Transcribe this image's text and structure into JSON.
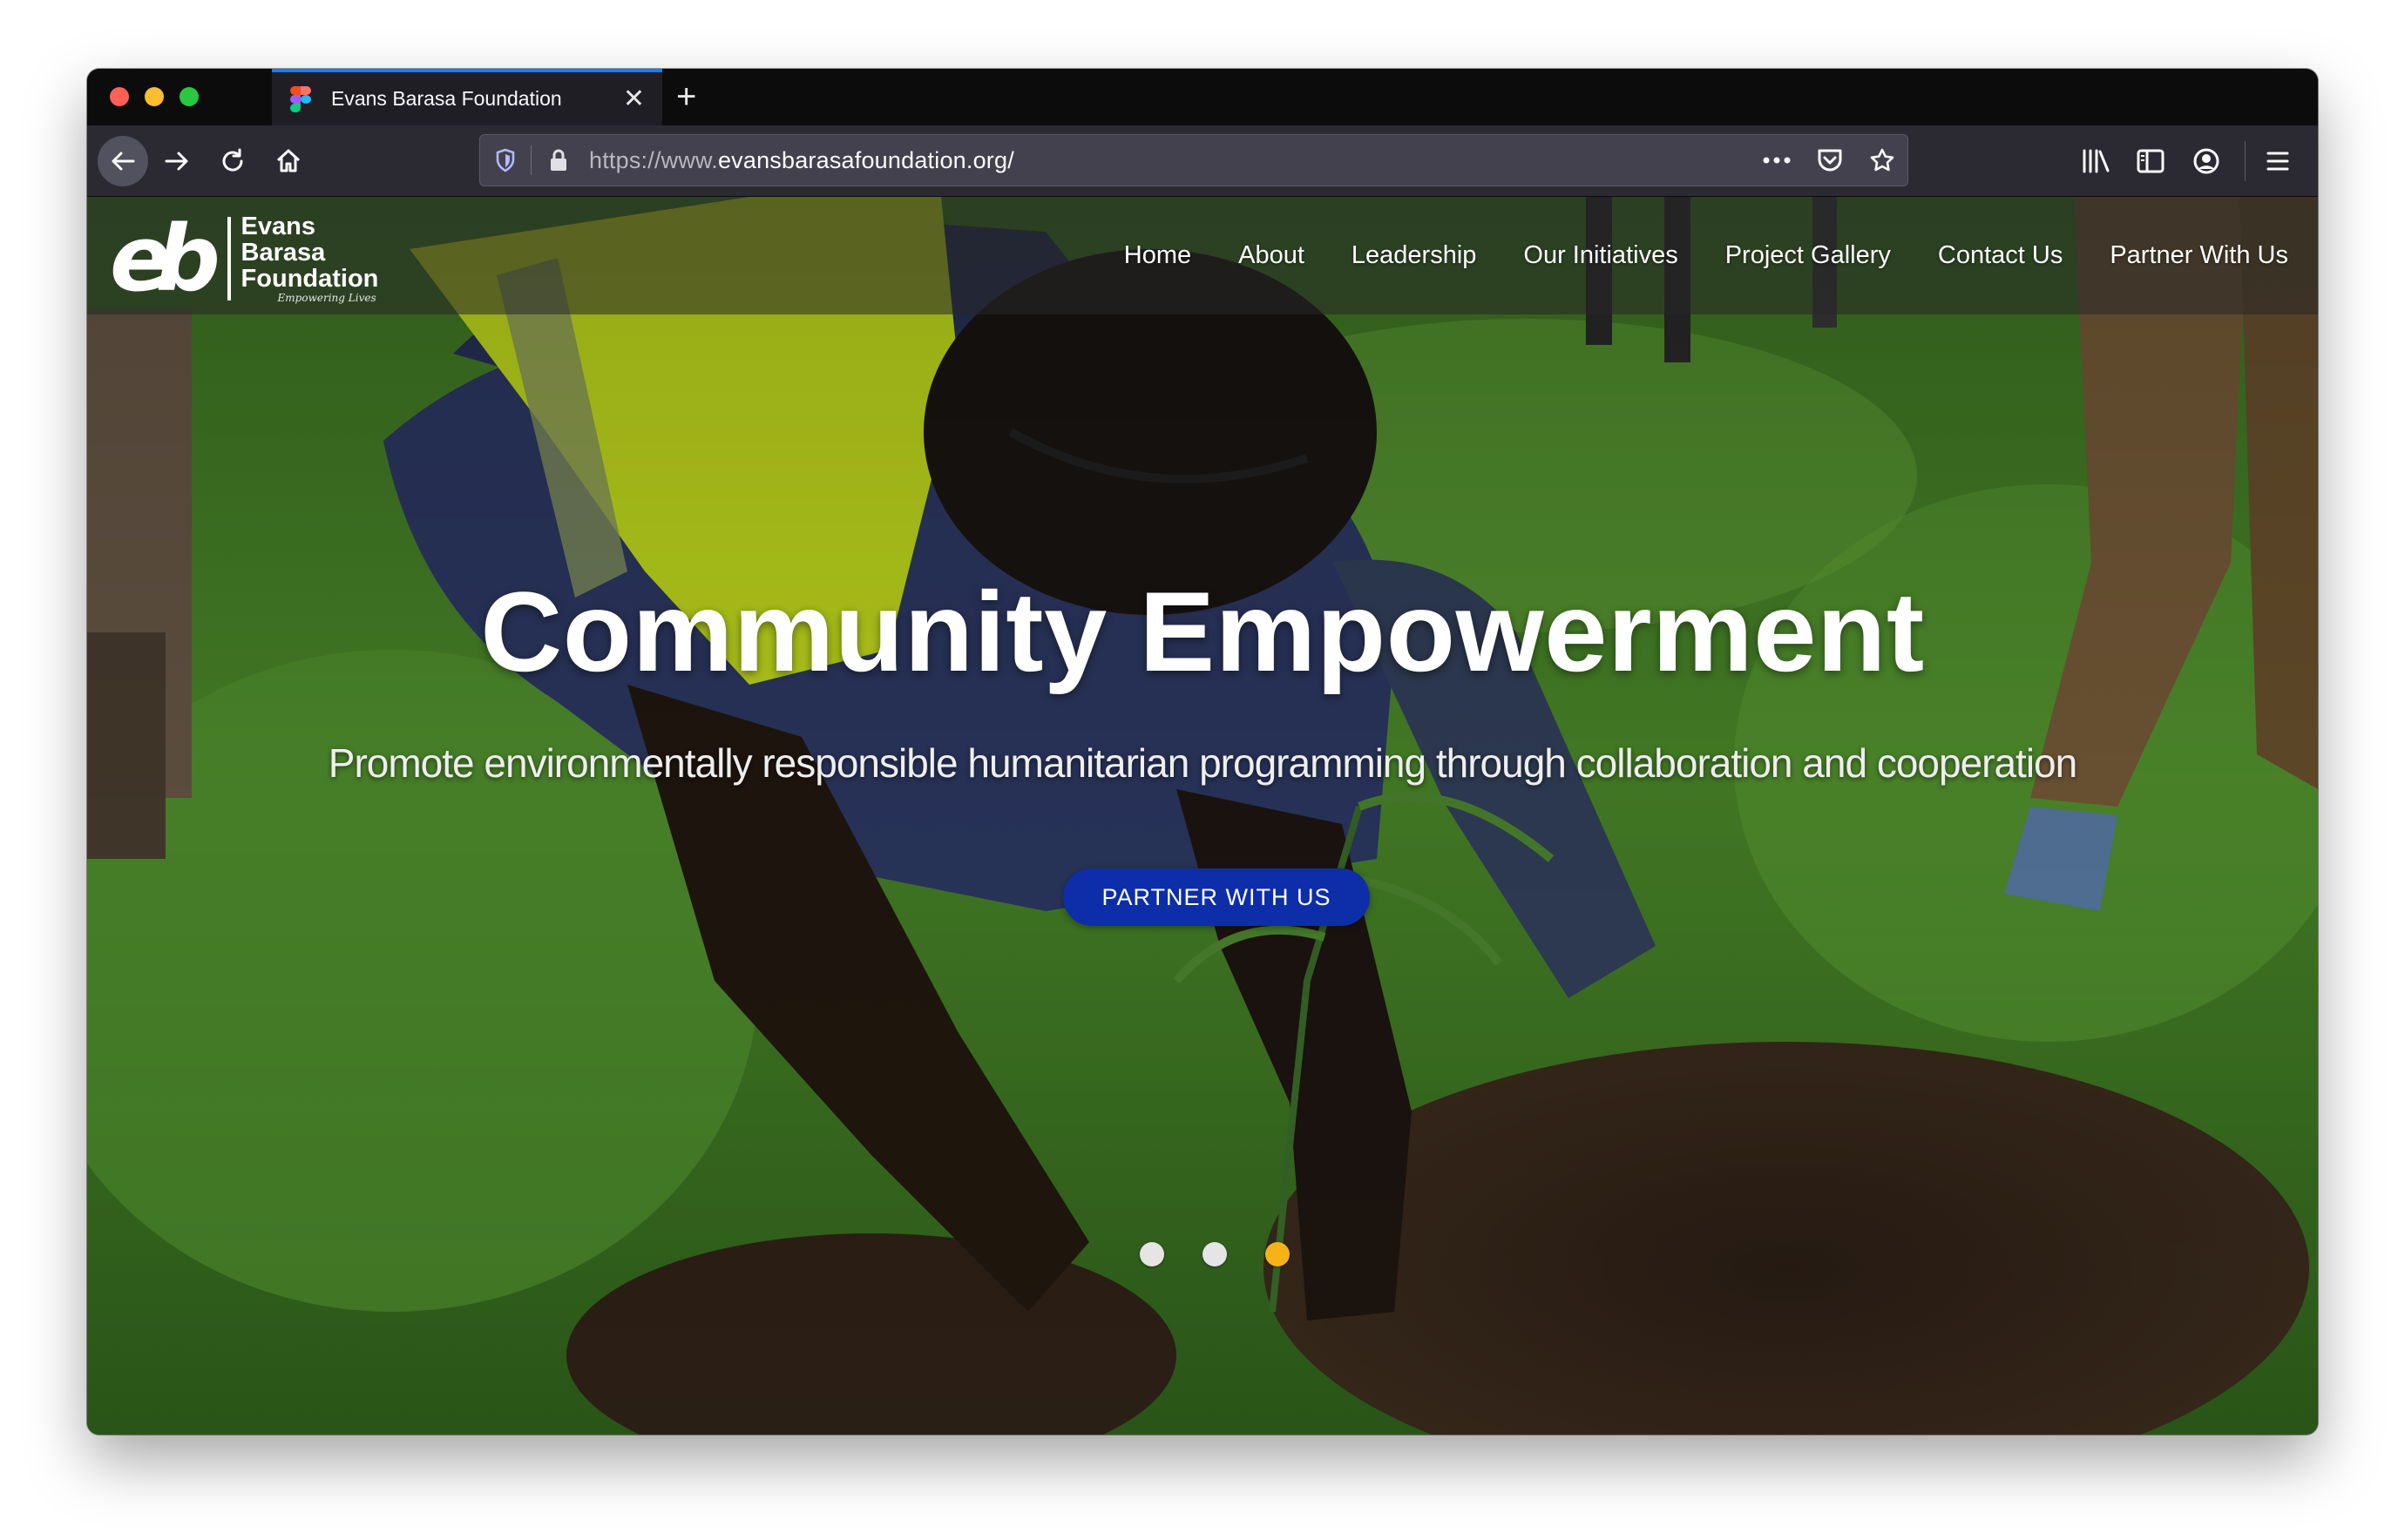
{
  "browser": {
    "tab_title": "Evans Barasa Foundation",
    "tab_favicon": "figma-icon",
    "url_prefix": "https://www.",
    "url_domain": "evansbarasafoundation.org/",
    "accent": "#0a84ff"
  },
  "site": {
    "logo_mark": "eb",
    "logo_name_line1": "Evans Barasa",
    "logo_name_line2": "Foundation",
    "logo_tagline": "Empowering Lives",
    "nav": [
      "Home",
      "About",
      "Leadership",
      "Our Initiatives",
      "Project Gallery",
      "Contact Us",
      "Partner With Us"
    ]
  },
  "hero": {
    "title": "Community Empowerment",
    "subtitle": "Promote environmentally responsible humanitarian programming through collaboration and cooperation",
    "cta_label": "PARTNER WITH US",
    "cta_color": "#0d2ea8",
    "slides_total": 3,
    "active_slide": 3,
    "active_dot_color": "#f5b318"
  }
}
